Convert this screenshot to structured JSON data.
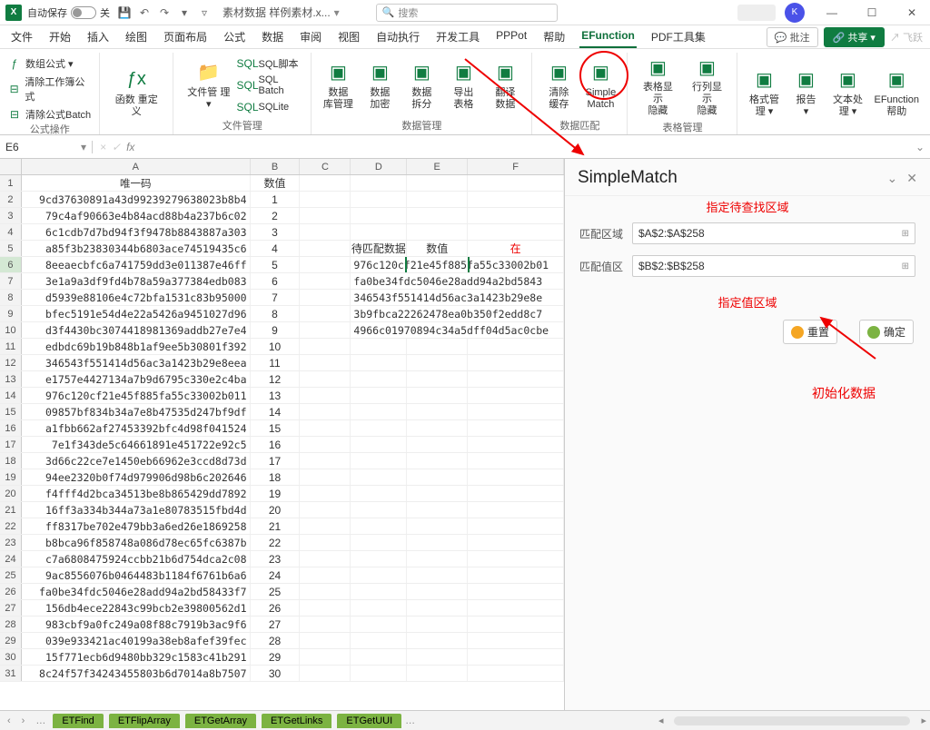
{
  "title_bar": {
    "autosave_label": "自动保存",
    "autosave_state": "关",
    "file_name": "素材数据 样例素材.x...",
    "search_placeholder": "搜索",
    "avatar_initial": "K"
  },
  "tabs": {
    "items": [
      "文件",
      "开始",
      "插入",
      "绘图",
      "页面布局",
      "公式",
      "数据",
      "审阅",
      "视图",
      "自动执行",
      "开发工具",
      "PPPot",
      "帮助",
      "EFunction",
      "PDF工具集"
    ],
    "active_index": 13,
    "comments_label": "批注",
    "share_label": "共享",
    "fly_label": "飞跃"
  },
  "ribbon": {
    "g0": {
      "label": "公式操作",
      "items": [
        "数组公式 ▾",
        "清除工作簿公式",
        "清除公式Batch"
      ]
    },
    "g1": {
      "label": "",
      "items": [
        {
          "lbl": "函数\n重定义"
        }
      ]
    },
    "g2": {
      "label": "文件管理",
      "items": [
        {
          "lbl": "文件管\n理 ▾"
        }
      ],
      "sql": [
        "SQL脚本",
        "SQL Batch",
        "SQLite"
      ]
    },
    "g3": {
      "label": "数据管理",
      "items": [
        {
          "lbl": "数据\n库管理"
        },
        {
          "lbl": "数据\n加密"
        },
        {
          "lbl": "数据\n拆分"
        },
        {
          "lbl": "导出\n表格"
        },
        {
          "lbl": "翻译\n数据"
        }
      ]
    },
    "g4": {
      "label": "数据匹配",
      "items": [
        {
          "lbl": "清除\n缓存"
        },
        {
          "lbl": "Simple\nMatch",
          "hl": true
        }
      ]
    },
    "g5": {
      "label": "表格管理",
      "items": [
        {
          "lbl": "表格显示\n隐藏"
        },
        {
          "lbl": "行列显示\n隐藏"
        }
      ]
    },
    "g6": {
      "label": "",
      "items": [
        {
          "lbl": "格式管\n理 ▾"
        },
        {
          "lbl": "报告\n▾"
        },
        {
          "lbl": "文本处\n理 ▾"
        },
        {
          "lbl": "EFunction\n帮助"
        }
      ]
    }
  },
  "formula": {
    "name_box": "E6",
    "fx": "fx"
  },
  "grid": {
    "columns": [
      "A",
      "B",
      "C",
      "D",
      "E",
      "F"
    ],
    "header_row": {
      "A": "唯一码",
      "B": "数值",
      "D": "待匹配数据",
      "E": "数值",
      "F": "在"
    },
    "selected_cell": {
      "row": 6,
      "col": "E"
    },
    "d_overflow": {
      "5": "976c120cf21e45f885fa55c33002b01",
      "6": "fa0be34fdc5046e28add94a2bd5843",
      "7": "346543f551414d56ac3a1423b29e8e",
      "8": "3b9fbca22262478ea0b350f2edd8c7",
      "9": "4966c01970894c34a5dff04d5ac0cbe"
    },
    "data": [
      {
        "A": "9cd37630891a43d99239279638023b8b4",
        "B": "1"
      },
      {
        "A": "79c4af90663e4b84acd88b4a237b6c02",
        "B": "2"
      },
      {
        "A": "6c1cdb7d7bd94f3f9478b8843887a303",
        "B": "3"
      },
      {
        "A": "a85f3b23830344b6803ace74519435c6",
        "B": "4"
      },
      {
        "A": "8eeaecbfc6a741759dd3e011387e46ff",
        "B": "5",
        "E": "45f885fa5"
      },
      {
        "A": "3e1a9a3df9fd4b78a59a377384edb083",
        "B": "6"
      },
      {
        "A": "d5939e88106e4c72bfa1531c83b95000",
        "B": "7"
      },
      {
        "A": "bfec5191e54d4e22a5426a9451027d96",
        "B": "8"
      },
      {
        "A": "d3f4430bc3074418981369addb27e7e4",
        "B": "9"
      },
      {
        "A": "edbdc69b19b848b1af9ee5b30801f392",
        "B": "10"
      },
      {
        "A": "346543f551414d56ac3a1423b29e8eea",
        "B": "11"
      },
      {
        "A": "e1757e4427134a7b9d6795c330e2c4ba",
        "B": "12"
      },
      {
        "A": "976c120cf21e45f885fa55c33002b011",
        "B": "13"
      },
      {
        "A": "09857bf834b34a7e8b47535d247bf9df",
        "B": "14"
      },
      {
        "A": "a1fbb662af27453392bfc4d98f041524",
        "B": "15"
      },
      {
        "A": "7e1f343de5c64661891e451722e92c5",
        "B": "16"
      },
      {
        "A": "3d66c22ce7e1450eb66962e3ccd8d73d",
        "B": "17"
      },
      {
        "A": "94ee2320b0f74d979906d98b6c202646",
        "B": "18"
      },
      {
        "A": "f4fff4d2bca34513be8b865429dd7892",
        "B": "19"
      },
      {
        "A": "16ff3a334b344a73a1e80783515fbd4d",
        "B": "20"
      },
      {
        "A": "ff8317be702e479bb3a6ed26e1869258",
        "B": "21"
      },
      {
        "A": "b8bca96f858748a086d78ec65fc6387b",
        "B": "22"
      },
      {
        "A": "c7a6808475924ccbb21b6d754dca2c08",
        "B": "23"
      },
      {
        "A": "9ac8556076b0464483b1184f6761b6a6",
        "B": "24"
      },
      {
        "A": "fa0be34fdc5046e28add94a2bd58433f7",
        "B": "25"
      },
      {
        "A": "156db4ece22843c99bcb2e39800562d1",
        "B": "26"
      },
      {
        "A": "983cbf9a0fc249a08f88c7919b3ac9f6",
        "B": "27"
      },
      {
        "A": "039e933421ac40199a38eb8afef39fec",
        "B": "28"
      },
      {
        "A": "15f771ecb6d9480bb329c1583c41b291",
        "B": "29"
      },
      {
        "A": "8c24f57f34243455803b6d7014a8b7507",
        "B": "30"
      }
    ]
  },
  "sheet_tabs": [
    "ETFind",
    "ETFlipArray",
    "ETGetArray",
    "ETGetLinks",
    "ETGetUUI"
  ],
  "panel": {
    "title": "SimpleMatch",
    "annot_top": "指定待查找区域",
    "field1_label": "匹配区域",
    "field1_value": "$A$2:$A$258",
    "field2_label": "匹配值区",
    "field2_value": "$B$2:$B$258",
    "annot_mid": "指定值区域",
    "btn_reset": "重置",
    "btn_ok": "确定",
    "annot_bottom": "初始化数据"
  }
}
